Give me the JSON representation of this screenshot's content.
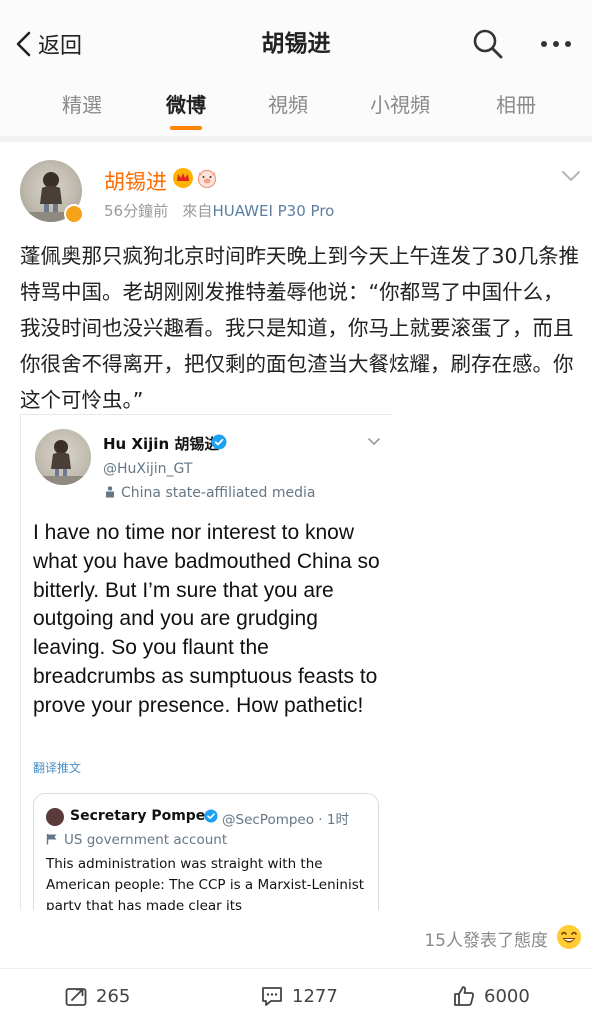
{
  "header": {
    "back_label": "返回",
    "title": "胡锡进"
  },
  "tabs": [
    {
      "label": "精選",
      "active": false
    },
    {
      "label": "微博",
      "active": true
    },
    {
      "label": "視頻",
      "active": false
    },
    {
      "label": "小視頻",
      "active": false
    },
    {
      "label": "相冊",
      "active": false
    }
  ],
  "post": {
    "author": "胡锡进",
    "time": "56分鐘前",
    "source_prefix": "來自",
    "source": "HUAWEI P30 Pro",
    "text": "蓬佩奥那只疯狗北京时间昨天晚上到今天上午连发了30几条推特骂中国。老胡刚刚发推特羞辱他说：“你都骂了中国什么，我没时间也没兴趣看。我只是知道，你马上就要滚蛋了，而且你很舍不得离开，把仅剩的面包渣当大餐炫耀，刷存在感。你这个可怜虫。”"
  },
  "tweet": {
    "name": "Hu Xijin 胡锡进",
    "handle": "@HuXijin_GT",
    "label": "China state-affiliated media",
    "body": "I have no time nor interest to know what you have badmouthed China so bitterly. But I’m sure that you are outgoing and you are grudging leaving. So you flaunt the breadcrumbs as sumptuous feasts to prove your presence. How pathetic!",
    "translate": "翻译推文",
    "quote": {
      "name": "Secretary Pompeo",
      "handle": "@SecPompeo · 1时",
      "label": "US government account",
      "text": "This administration was straight with the American people: The CCP is a Marxist-Leninist party that has made clear its"
    }
  },
  "reactions": {
    "text": "15人發表了態度"
  },
  "actions": {
    "repost_count": "265",
    "comment_count": "1277",
    "like_count": "6000"
  },
  "colors": {
    "accent": "#ff8200",
    "username": "#ff6c00",
    "source_link": "#5d7ea3",
    "twitter_blue": "#1da1f2"
  }
}
